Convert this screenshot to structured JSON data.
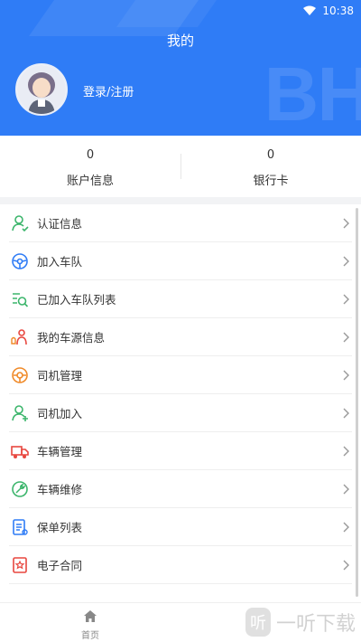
{
  "status_bar": {
    "time": "10:38"
  },
  "header": {
    "title": "我的",
    "login_label": "登录/注册"
  },
  "stats": [
    {
      "value": "0",
      "label": "账户信息"
    },
    {
      "value": "0",
      "label": "银行卡"
    }
  ],
  "menu": [
    {
      "label": "认证信息",
      "icon": "person-check-icon"
    },
    {
      "label": "加入车队",
      "icon": "steering-wheel-icon"
    },
    {
      "label": "已加入车队列表",
      "icon": "list-search-icon"
    },
    {
      "label": "我的车源信息",
      "icon": "car-source-icon"
    },
    {
      "label": "司机管理",
      "icon": "steering-circle-icon"
    },
    {
      "label": "司机加入",
      "icon": "person-add-icon"
    },
    {
      "label": "车辆管理",
      "icon": "truck-icon"
    },
    {
      "label": "车辆维修",
      "icon": "wrench-icon"
    },
    {
      "label": "保单列表",
      "icon": "document-list-icon"
    },
    {
      "label": "电子合同",
      "icon": "contract-icon"
    }
  ],
  "tabbar": {
    "home_label": "首页"
  },
  "watermark": {
    "glyph": "听",
    "text": "一听下载"
  },
  "colors": {
    "primary": "#2f7cf6",
    "green": "#3bb56b",
    "blue": "#2f7cf6",
    "orange": "#f08a28",
    "red": "#e8473f"
  }
}
